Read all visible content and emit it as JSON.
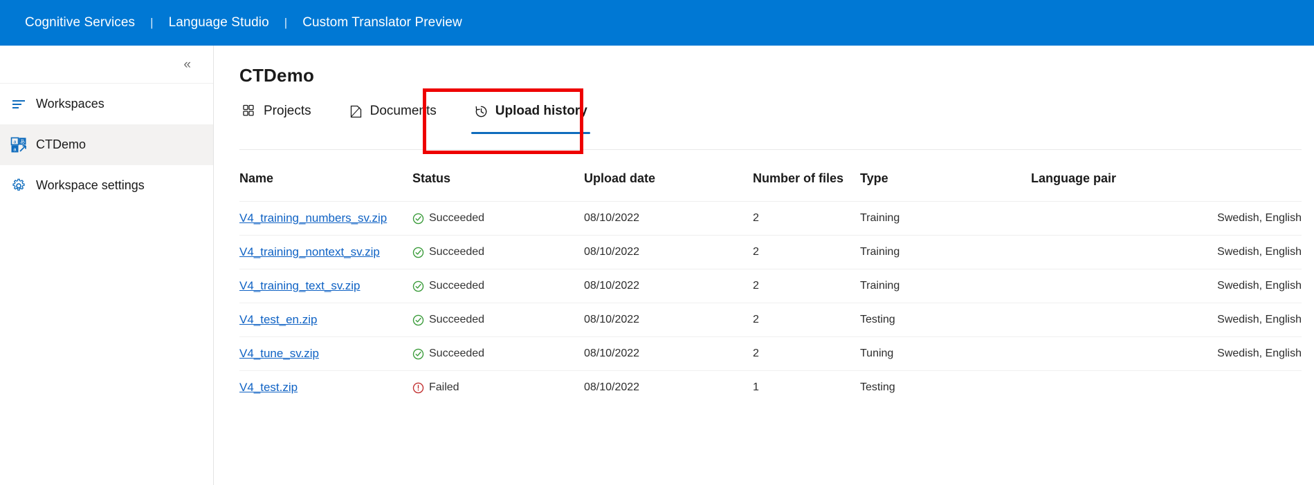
{
  "topbar": {
    "links": [
      "Cognitive Services",
      "Language Studio",
      "Custom Translator Preview"
    ],
    "separator": "|",
    "background": "#0078D4"
  },
  "sidebar": {
    "collapse_icon": "chevron-double-left-icon",
    "items": [
      {
        "label": "Workspaces",
        "icon": "list-icon",
        "selected": false
      },
      {
        "label": "CTDemo",
        "icon": "translate-icon",
        "selected": true
      },
      {
        "label": "Workspace settings",
        "icon": "gear-icon",
        "selected": false
      }
    ]
  },
  "main": {
    "title": "CTDemo",
    "tabs": [
      {
        "label": "Projects",
        "icon": "projects-icon",
        "active": false
      },
      {
        "label": "Documents",
        "icon": "documents-icon",
        "active": false
      },
      {
        "label": "Upload history",
        "icon": "history-clock-icon",
        "active": true
      }
    ],
    "highlight": {
      "color": "#ee0000",
      "target": "Upload history"
    },
    "table": {
      "columns": [
        "Name",
        "Status",
        "Upload date",
        "Number of files",
        "Type",
        "Language pair"
      ],
      "rows": [
        {
          "name": "V4_training_numbers_sv.zip",
          "status": "Succeeded",
          "status_kind": "success",
          "date": "08/10/2022",
          "files": "2",
          "type": "Training",
          "language_pair": "Swedish, English"
        },
        {
          "name": "V4_training_nontext_sv.zip",
          "status": "Succeeded",
          "status_kind": "success",
          "date": "08/10/2022",
          "files": "2",
          "type": "Training",
          "language_pair": "Swedish, English"
        },
        {
          "name": "V4_training_text_sv.zip",
          "status": "Succeeded",
          "status_kind": "success",
          "date": "08/10/2022",
          "files": "2",
          "type": "Training",
          "language_pair": "Swedish, English"
        },
        {
          "name": "V4_test_en.zip",
          "status": "Succeeded",
          "status_kind": "success",
          "date": "08/10/2022",
          "files": "2",
          "type": "Testing",
          "language_pair": "Swedish, English"
        },
        {
          "name": "V4_tune_sv.zip",
          "status": "Succeeded",
          "status_kind": "success",
          "date": "08/10/2022",
          "files": "2",
          "type": "Tuning",
          "language_pair": "Swedish, English"
        },
        {
          "name": "V4_test.zip",
          "status": "Failed",
          "status_kind": "error",
          "date": "08/10/2022",
          "files": "1",
          "type": "Testing",
          "language_pair": ""
        }
      ]
    }
  },
  "colors": {
    "brand_blue": "#0078D4",
    "accent_blue": "#0f6cbd",
    "link_blue": "#0f62c4",
    "success_green": "#3a9b3a",
    "error_red": "#c23030",
    "highlight_red": "#ee0000",
    "selected_bg": "#f3f2f1"
  }
}
